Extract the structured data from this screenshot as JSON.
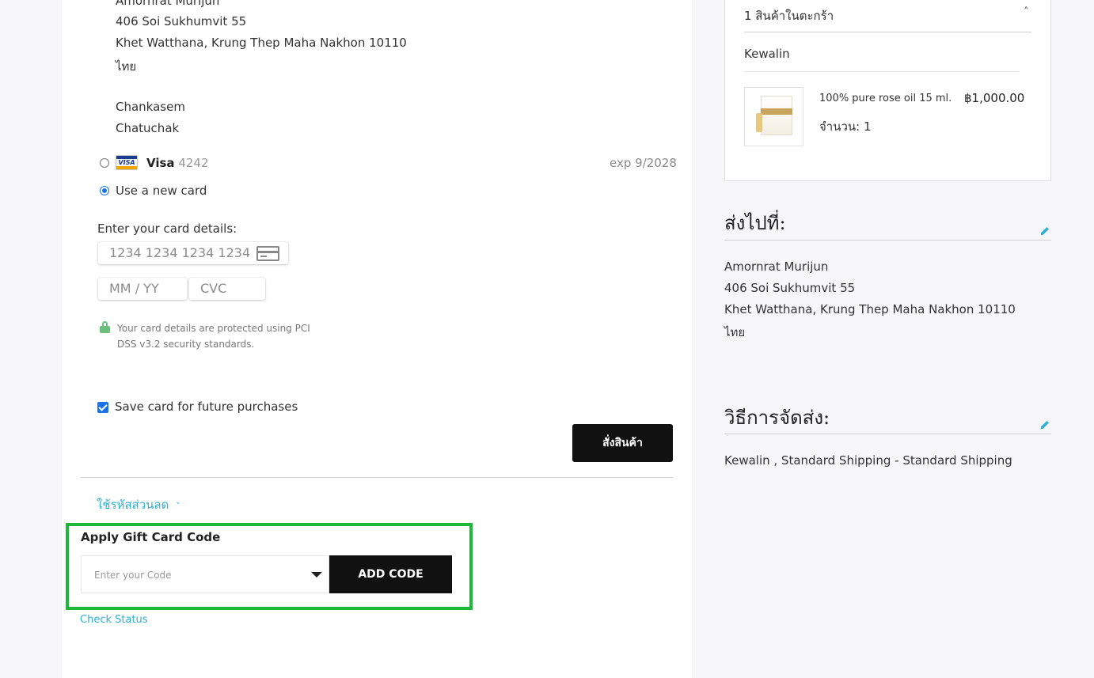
{
  "shipping_address": {
    "name_partial": "Amornrat Murijun",
    "street": "406 Soi Sukhumvit 55",
    "city": "Khet Watthana, Krung Thep Maha Nakhon 10110",
    "country": "ไทย",
    "district": "Chankasem",
    "subdistrict": "Chatuchak"
  },
  "payment": {
    "saved_card": {
      "brand": "Visa",
      "last4": "4242",
      "expiry": "exp 9/2028",
      "logo_text": "VISA"
    },
    "new_card_label": "Use a new card",
    "card_details_label": "Enter your card details:",
    "card_number_placeholder": "1234 1234 1234 1234",
    "expiry_placeholder": "MM / YY",
    "cvc_placeholder": "CVC",
    "security_note": "Your card details are protected using PCI DSS v3.2 security standards.",
    "save_card_label": "Save card for future purchases",
    "place_order_label": "สั่งสินค้า"
  },
  "discount": {
    "label": "ใช้รหัสส่วนลด",
    "chevron": "˅"
  },
  "gift_card": {
    "title": "Apply Gift Card Code",
    "input_placeholder": "Enter your Code",
    "add_button": "ADD CODE",
    "check_status": "Check Status"
  },
  "cart": {
    "summary": "1 สินค้าในตะกร้า",
    "chevron": "˄",
    "vendor": "Kewalin",
    "item": {
      "name": "100% pure rose oil 15 ml.",
      "price": "฿1,000.00",
      "qty": "จำนวน: 1"
    }
  },
  "ship_to": {
    "title": "ส่งไปที่:",
    "name": "Amornrat Murijun",
    "street": "406 Soi Sukhumvit 55",
    "city": "Khet Watthana, Krung Thep Maha Nakhon 10110",
    "country": "ไทย"
  },
  "shipping_method": {
    "title": "วิธีการจัดส่ง:",
    "value": "Kewalin , Standard Shipping - Standard Shipping"
  },
  "colors": {
    "accent_blue": "#1a73e8",
    "link": "#2bb0d6",
    "highlight": "#1bb83c",
    "button": "#111111"
  }
}
